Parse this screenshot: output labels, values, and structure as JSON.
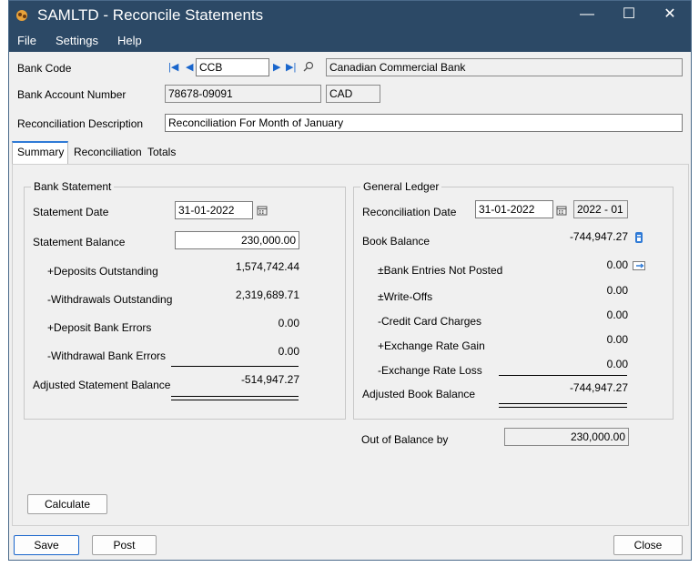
{
  "window": {
    "title": "SAMLTD - Reconcile Statements",
    "minimize_glyph": "—",
    "maximize_glyph": "☐",
    "close_glyph": "✕"
  },
  "menu": [
    "File",
    "Settings",
    "Help"
  ],
  "header": {
    "bank_code_label": "Bank Code",
    "bank_code": "CCB",
    "bank_name": "Canadian Commercial Bank",
    "account_label": "Bank Account Number",
    "account_number": "78678-09091",
    "currency": "CAD",
    "description_label": "Reconciliation Description",
    "description": "Reconciliation For Month of January"
  },
  "tabs": [
    "Summary",
    "Reconciliation",
    "Totals"
  ],
  "bank_statement": {
    "title": "Bank Statement",
    "date_label": "Statement Date",
    "date": "31-01-2022",
    "balance_label": "Statement Balance",
    "balance": "230,000.00",
    "deposits_label": "+Deposits Outstanding",
    "deposits": "1,574,742.44",
    "withdrawals_label": "-Withdrawals Outstanding",
    "withdrawals": "2,319,689.71",
    "dep_errors_label": "+Deposit Bank Errors",
    "dep_errors": "0.00",
    "wd_errors_label": "-Withdrawal Bank Errors",
    "wd_errors": "0.00",
    "adjusted_label": "Adjusted Statement Balance",
    "adjusted": "-514,947.27"
  },
  "general_ledger": {
    "title": "General Ledger",
    "date_label": "Reconciliation Date",
    "date": "31-01-2022",
    "period": "2022 - 01",
    "book_label": "Book Balance",
    "book": "-744,947.27",
    "entries_label": "±Bank Entries Not Posted",
    "entries": "0.00",
    "writeoffs_label": "±Write-Offs",
    "writeoffs": "0.00",
    "cc_label": "-Credit Card Charges",
    "cc": "0.00",
    "gain_label": "+Exchange Rate Gain",
    "gain": "0.00",
    "loss_label": "-Exchange Rate Loss",
    "loss": "0.00",
    "adjusted_label": "Adjusted Book Balance",
    "adjusted": "-744,947.27"
  },
  "out_of_balance": {
    "label": "Out of Balance by",
    "value": "230,000.00"
  },
  "buttons": {
    "calculate": "Calculate",
    "save": "Save",
    "post": "Post",
    "close": "Close"
  },
  "colors": {
    "titlebar": "#2c4966",
    "accent": "#1a66cc"
  }
}
